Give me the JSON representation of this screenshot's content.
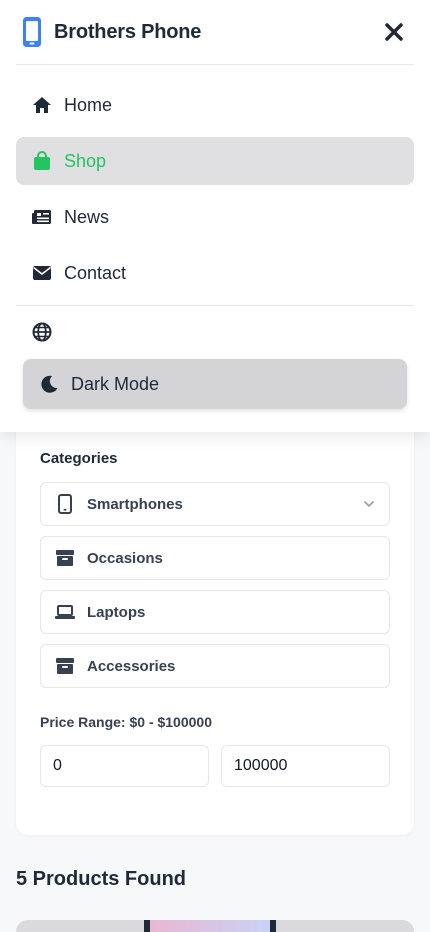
{
  "header": {
    "brand_name": "Brothers Phone",
    "logo_icon": "smartphone-icon",
    "close_icon": "close-icon"
  },
  "nav": {
    "items": [
      {
        "label": "Home",
        "icon": "home-icon",
        "active": false
      },
      {
        "label": "Shop",
        "icon": "shopping-bag-icon",
        "active": true
      },
      {
        "label": "News",
        "icon": "newspaper-icon",
        "active": false
      },
      {
        "label": "Contact",
        "icon": "envelope-icon",
        "active": false
      }
    ],
    "language_icon": "globe-icon",
    "dark_mode_label": "Dark Mode",
    "dark_mode_icon": "moon-icon"
  },
  "filters": {
    "categories_title": "Categories",
    "categories": [
      {
        "label": "Smartphones",
        "icon": "smartphone-icon",
        "expandable": true
      },
      {
        "label": "Occasions",
        "icon": "box-icon",
        "expandable": false
      },
      {
        "label": "Laptops",
        "icon": "laptop-icon",
        "expandable": false
      },
      {
        "label": "Accessories",
        "icon": "box-icon",
        "expandable": false
      }
    ],
    "price_label": "Price Range: $0 - $100000",
    "price_min": "0",
    "price_max": "100000"
  },
  "results": {
    "count_label": "5 Products Found"
  },
  "colors": {
    "accent": "#22c55e",
    "brand_blue": "#3b82f6",
    "text": "#1f2937"
  }
}
